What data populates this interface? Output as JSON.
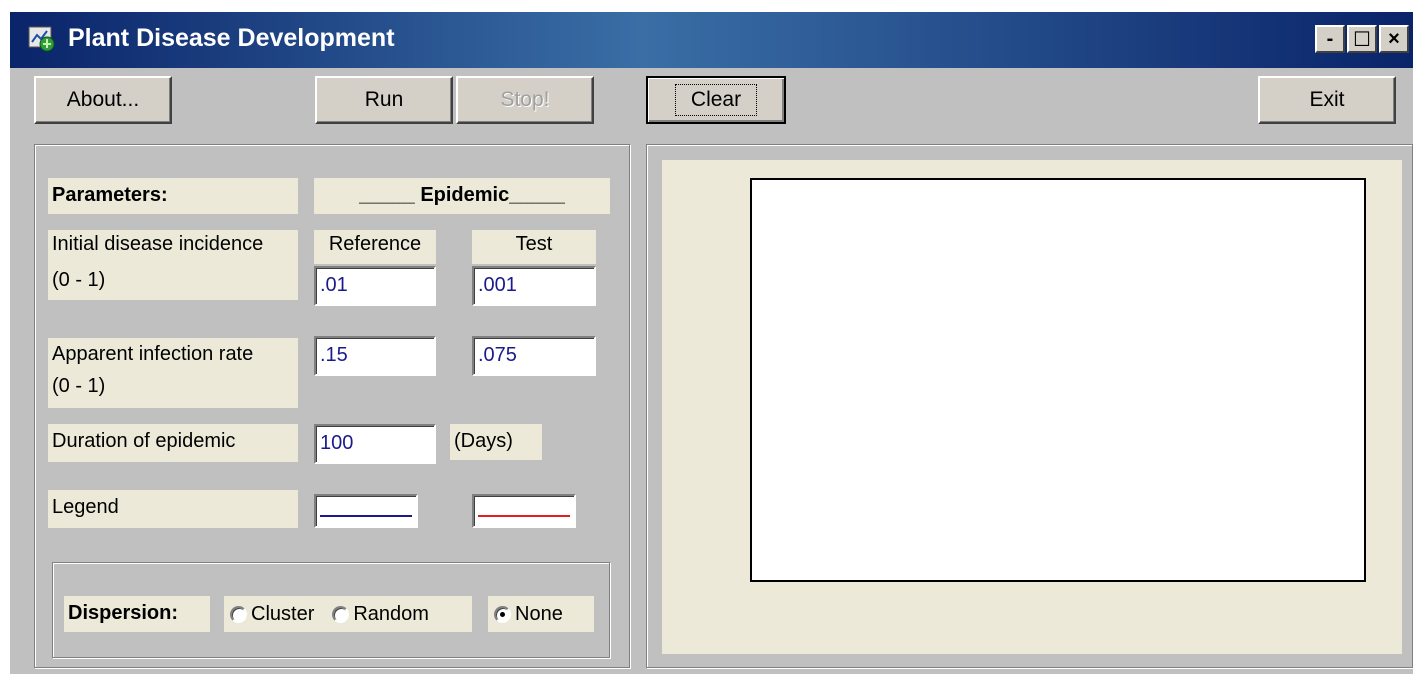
{
  "window": {
    "title": "Plant Disease Development",
    "controls": {
      "minimize": "-",
      "maximize": "☐",
      "close": "×"
    }
  },
  "toolbar": {
    "about": "About...",
    "run": "Run",
    "stop": "Stop!",
    "clear": "Clear",
    "exit": "Exit"
  },
  "params": {
    "heading": "Parameters:",
    "epidemic_heading": "_____ Epidemic_____",
    "reference_label": "Reference",
    "test_label": "Test",
    "initial_incidence_label": "Initial disease incidence",
    "initial_incidence_range": "(0 - 1)",
    "initial_reference": ".01",
    "initial_test": ".001",
    "infection_rate_label": "Apparent infection rate",
    "infection_rate_range": "(0 - 1)",
    "rate_reference": ".15",
    "rate_test": ".075",
    "duration_label": "Duration of epidemic",
    "duration_value": "100",
    "duration_unit": "(Days)",
    "legend_label": "Legend",
    "legend_reference_color": "#1a1a8c",
    "legend_test_color": "#e02020"
  },
  "dispersion": {
    "label": "Dispersion:",
    "options": [
      "Cluster",
      "Random",
      "None"
    ],
    "selected": "None"
  }
}
